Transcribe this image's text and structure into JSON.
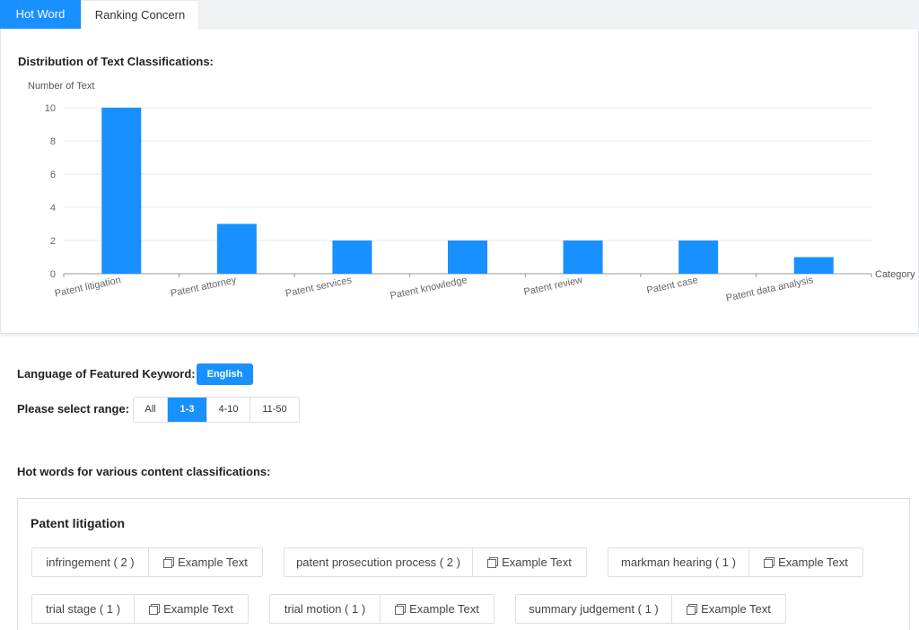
{
  "tabs": {
    "hot_word": "Hot Word",
    "ranking_concern": "Ranking Concern"
  },
  "colors": {
    "accent": "#1890ff",
    "bar": "#1890ff"
  },
  "chart_section": {
    "title": "Distribution of Text Classifications:"
  },
  "chart_data": {
    "type": "bar",
    "ylabel": "Number of Text",
    "xlabel": "Category",
    "categories": [
      "Patent litigation",
      "Patent attorney",
      "Patent services",
      "Patent knowledge",
      "Patent review",
      "Patent case",
      "Patent data analysis"
    ],
    "values": [
      10,
      3,
      2,
      2,
      2,
      2,
      1
    ],
    "ylim": [
      0,
      10
    ],
    "yticks": [
      0,
      2,
      4,
      6,
      8,
      10
    ],
    "grid": true
  },
  "filters": {
    "language_label": "Language of Featured Keyword:",
    "language_value": "English",
    "range_label": "Please select range:",
    "range_options": [
      "All",
      "1-3",
      "4-10",
      "11-50"
    ],
    "range_selected": "1-3"
  },
  "hotwords_section": {
    "title": "Hot words for various content classifications:"
  },
  "hotword_card": {
    "title": "Patent litigation",
    "example_label": "Example Text",
    "keywords": [
      "infringement ( 2 )",
      "patent prosecution process ( 2 )",
      "markman hearing ( 1 )",
      "trial stage ( 1 )",
      "trial motion ( 1 )",
      "summary judgement ( 1 )"
    ]
  }
}
